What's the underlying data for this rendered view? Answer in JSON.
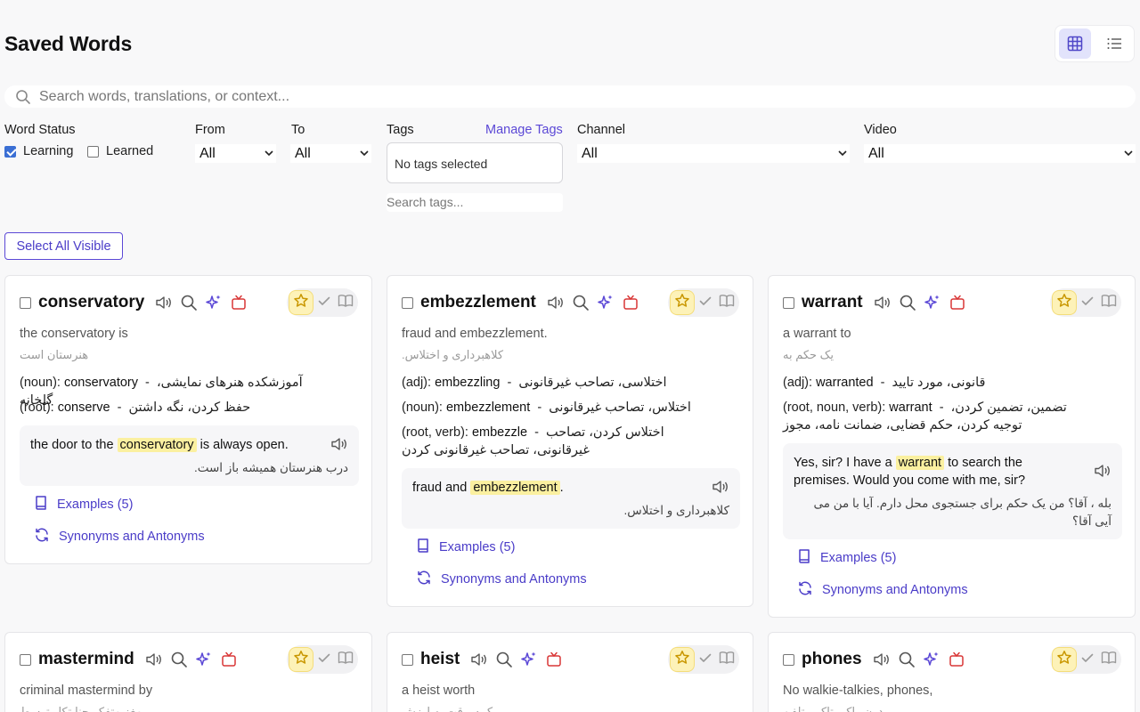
{
  "header": {
    "title": "Saved Words",
    "view_modes": [
      "grid-icon",
      "list-icon"
    ],
    "active_view": "grid"
  },
  "search": {
    "placeholder": "Search words, translations, or context..."
  },
  "filters": {
    "word_status_label": "Word Status",
    "learning_label": "Learning",
    "learning_checked": true,
    "learned_label": "Learned",
    "learned_checked": false,
    "from_label": "From",
    "from_value": "All",
    "to_label": "To",
    "to_value": "All",
    "tags_label": "Tags",
    "manage_tags": "Manage Tags",
    "tags_selected": "No tags selected",
    "tags_search_placeholder": "Search tags...",
    "channel_label": "Channel",
    "channel_value": "All",
    "video_label": "Video",
    "video_value": "All"
  },
  "select_all_label": "Select All Visible",
  "colors": {
    "accent": "#5b48d6",
    "highlight": "#fbf0a0",
    "star": "#e5b400",
    "tv": "#d93636"
  },
  "cards": [
    {
      "word": "conservatory",
      "context": "the conservatory is",
      "context_translation": "هنرستان است",
      "definitions": [
        {
          "pos": "(noun):",
          "form": "conservatory",
          "meaning": "آموزشکده هنرهای نمایشی، گلخانه"
        },
        {
          "pos": "(root):",
          "form": "conserve",
          "meaning": "حفظ کردن، نگه داشتن"
        }
      ],
      "example": {
        "before": "the door to the",
        "highlight": "conservatory",
        "after": "is always open.",
        "translation": "درب هنرستان همیشه باز است."
      },
      "examples_link": "Examples (5)",
      "synonyms_link": "Synonyms and Antonyms"
    },
    {
      "word": "embezzlement",
      "context": "fraud and embezzlement.",
      "context_translation": "کلاهبرداری و اختلاس.",
      "definitions": [
        {
          "pos": "(adj):",
          "form": "embezzling",
          "meaning": "اختلاسی، تصاحب غیرقانونی"
        },
        {
          "pos": "(noun):",
          "form": "embezzlement",
          "meaning": "اختلاس، تصاحب غیرقانونی"
        },
        {
          "pos": "(root, verb):",
          "form": "embezzle",
          "meaning": "اختلاس کردن، تصاحب غیرقانونی، تصاحب غیرقانونی کردن"
        }
      ],
      "example": {
        "before": "fraud and",
        "highlight": "embezzlement",
        "after": ".",
        "translation": "کلاهبرداری و اختلاس."
      },
      "examples_link": "Examples (5)",
      "synonyms_link": "Synonyms and Antonyms"
    },
    {
      "word": "warrant",
      "context": "a warrant to",
      "context_translation": "یک حکم به",
      "definitions": [
        {
          "pos": "(adj):",
          "form": "warranted",
          "meaning": "قانونی، مورد تایید"
        },
        {
          "pos": "(root, noun, verb):",
          "form": "warrant",
          "meaning": "تضمین، تضمین کردن، توجیه کردن، حکم قضایی، ضمانت نامه، مجوز"
        }
      ],
      "example": {
        "before": "Yes, sir? I have a",
        "highlight": "warrant",
        "after": "to search the premises. Would you come with me, sir?",
        "translation": "بله ، آقا؟ من یک حکم برای جستجوی محل دارم. آیا با من می آیی آقا؟"
      },
      "examples_link": "Examples (5)",
      "synonyms_link": "Synonyms and Antonyms"
    },
    {
      "word": "mastermind",
      "context": "criminal mastermind by",
      "context_translation": "مغز متفکر جنایتکار توسط"
    },
    {
      "word": "heist",
      "context": "a heist worth",
      "context_translation": "یک سرقت به ارزش"
    },
    {
      "word": "phones",
      "context": "No walkie-talkies, phones,",
      "context_translation": "بدون واکی تاکی، تلفن"
    }
  ]
}
